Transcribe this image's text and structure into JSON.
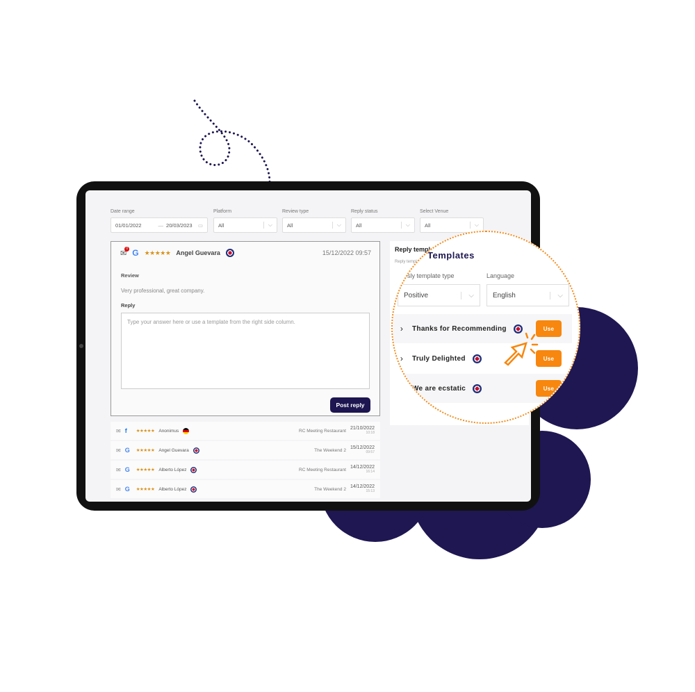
{
  "filters": [
    {
      "label": "Date range",
      "from": "01/01/2022",
      "separator": "—",
      "to": "20/03/2023",
      "icon": "calendar-icon"
    },
    {
      "label": "Platform",
      "value": "All"
    },
    {
      "label": "Review type",
      "value": "All"
    },
    {
      "label": "Reply status",
      "value": "All"
    },
    {
      "label": "Select Venue",
      "value": "All"
    }
  ],
  "review": {
    "unread_count": "0",
    "platform": "google",
    "stars": "★★★★★",
    "author": "Angel Guevara",
    "flag": "uk",
    "datetime": "15/12/2022 09:57",
    "review_label": "Review",
    "review_text": "Very professional, great company.",
    "reply_label": "Reply",
    "reply_placeholder": "Type your answer here or use a template from the right side column.",
    "post_button": "Post reply"
  },
  "list": [
    {
      "platform": "f",
      "stars": "★★★★★",
      "author": "Anonimus",
      "flag": "de",
      "venue": "RC Meeting Restaurant",
      "date": "21/10/2022",
      "time": "10:18"
    },
    {
      "platform": "G",
      "stars": "★★★★★",
      "author": "Angel Guevara",
      "flag": "uk",
      "venue": "The Weekend 2",
      "date": "15/12/2022",
      "time": "09:57"
    },
    {
      "platform": "G",
      "stars": "★★★★★",
      "author": "Alberto López",
      "flag": "uk",
      "venue": "RC Meeting Restaurant",
      "date": "14/12/2022",
      "time": "16:14"
    },
    {
      "platform": "G",
      "stars": "★★★★★",
      "author": "Alberto López",
      "flag": "uk",
      "venue": "The Weekend 2",
      "date": "14/12/2022",
      "time": "15:13"
    }
  ],
  "panel": {
    "title": "Reply templates",
    "sub_label": "Reply template"
  },
  "magnifier": {
    "title": "Templates",
    "type_label": "Posly template type",
    "type_value": "Positive",
    "language_label": "Language",
    "language_value": "English",
    "templates": [
      {
        "name": "Thanks for Recommending",
        "use": "Use"
      },
      {
        "name": "Truly Delighted",
        "use": "Use"
      },
      {
        "name": "We are ecstatic",
        "use": "Use"
      }
    ]
  },
  "colors": {
    "accent": "#f7870e",
    "navy": "#1d1650"
  }
}
